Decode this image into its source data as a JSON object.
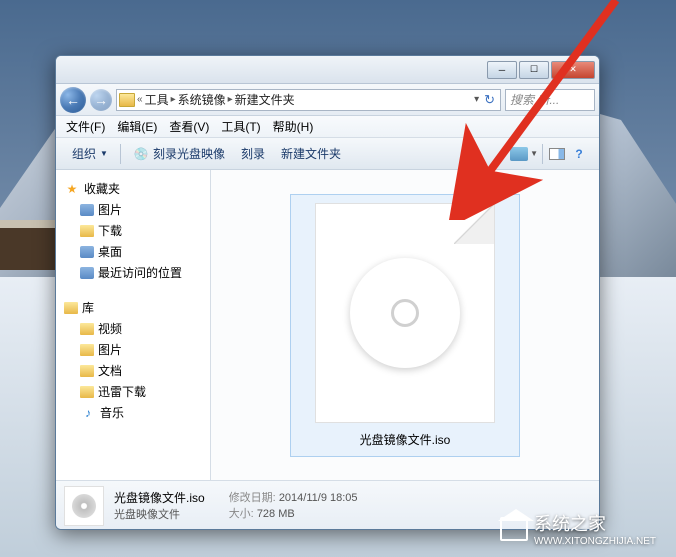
{
  "breadcrumb": {
    "seg1": "工具",
    "seg2": "系统镜像",
    "seg3": "新建文件夹"
  },
  "search": {
    "placeholder": "搜索 新..."
  },
  "menu": {
    "file": "文件(F)",
    "edit": "编辑(E)",
    "view": "查看(V)",
    "tools": "工具(T)",
    "help": "帮助(H)"
  },
  "toolbar": {
    "organize": "组织",
    "burn_image": "刻录光盘映像",
    "burn": "刻录",
    "new_folder": "新建文件夹"
  },
  "sidebar": {
    "favorites": {
      "label": "收藏夹",
      "items": [
        "图片",
        "下载",
        "桌面",
        "最近访问的位置"
      ]
    },
    "libraries": {
      "label": "库",
      "items": [
        "视频",
        "图片",
        "文档",
        "迅雷下载",
        "音乐"
      ]
    }
  },
  "file": {
    "name": "光盘镜像文件.iso"
  },
  "details": {
    "name": "光盘镜像文件.iso",
    "type": "光盘映像文件",
    "modified_label": "修改日期:",
    "modified_value": "2014/11/9 18:05",
    "size_label": "大小:",
    "size_value": "728 MB"
  },
  "watermark": {
    "title": "系统之家",
    "url": "WWW.XITONGZHIJIA.NET"
  }
}
